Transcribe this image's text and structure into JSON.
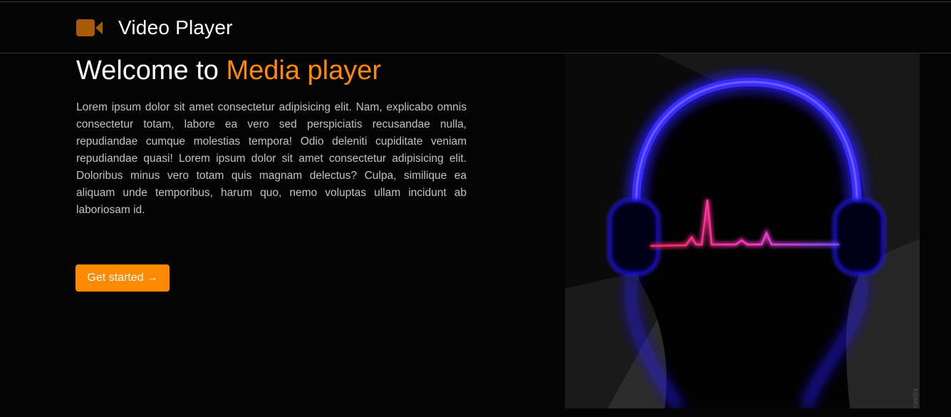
{
  "navbar": {
    "brand_icon": "video-camera-icon",
    "brand_label": "Video Player"
  },
  "hero": {
    "title_prefix": "Welcome to ",
    "title_accent": "Media player",
    "body": "Lorem ipsum dolor sit amet consectetur adipisicing elit. Nam, explicabo omnis consectetur totam, labore ea vero sed perspiciatis recusandae nulla, repudiandae cumque molestias tempora! Odio deleniti cupiditate veniam repudiandae quasi! Lorem ipsum dolor sit amet consectetur adipisicing elit. Doloribus minus vero totam quis magnam delectus? Culpa, similique ea aliquam unde temporibus, harum quo, nemo voluptas ullam incidunt ab laboriosam id.",
    "cta_label": "Get started",
    "cta_icon": "arrow-right-icon",
    "image_icon": "headphones-heartbeat-illustration",
    "image_watermark": "KIDMOGRAPH"
  },
  "colors": {
    "accent": "#ff8a00",
    "background": "#040404",
    "text_body": "#c2c2c2",
    "glow_blue": "#3a2cff",
    "pulse_pink": "#ff3c9c"
  }
}
